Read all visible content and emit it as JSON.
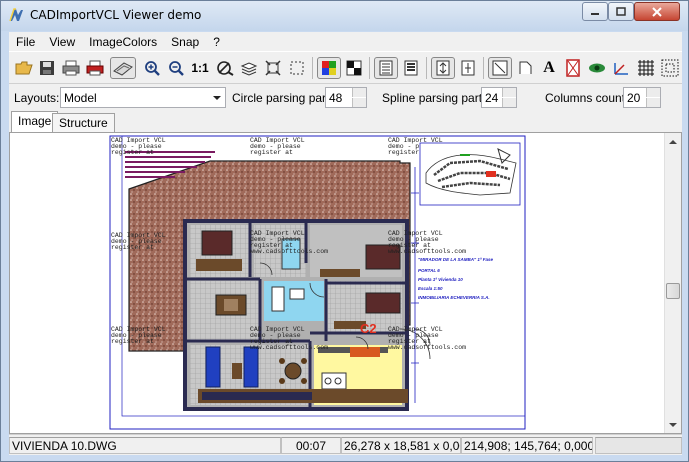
{
  "window": {
    "title": "CADImportVCL Viewer demo"
  },
  "menu": [
    "File",
    "View",
    "ImageColors",
    "Snap",
    "?"
  ],
  "toolbar": {
    "zoom_ratio_label": "1:1",
    "text_glyph": "A"
  },
  "options": {
    "layouts_label": "Layouts:",
    "layouts_value": "Model",
    "circle_label": "Circle parsing parts:",
    "circle_value": "48",
    "spline_label": "Spline parsing parts:",
    "spline_value": "24",
    "columns_label": "Columns count:",
    "columns_value": "20"
  },
  "tabs": [
    "Image",
    "Structure"
  ],
  "drawing": {
    "watermark_lines": [
      "CAD Import VCL",
      "demo - please",
      "register at",
      "www.cadsofttools.com"
    ],
    "legend_title": "\"MIRADOR DE LA SAMBA\"  1ª Fase",
    "legend_lines": [
      "PORTAL 6",
      "Planta 1ª  Vivienda 10",
      "Escala 1:50",
      "INMOBILIARIA ECHEVERRIA S.A."
    ],
    "room_mark": "C2"
  },
  "status": {
    "file": "VIVIENDA 10.DWG",
    "time": "00:07",
    "dimensions": "26,278 x 18,581 x 0,000",
    "coords": "214,908; 145,764; 0,000"
  }
}
